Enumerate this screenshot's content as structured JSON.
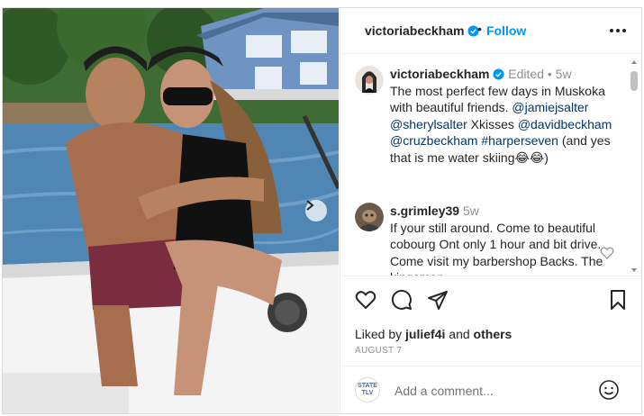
{
  "post": {
    "username": "victoriabeckham",
    "follow_label": "Follow",
    "dot": "•",
    "more_icon": "more-horizontal-icon",
    "verified_color": "#0095f6",
    "accent": "#0095f6"
  },
  "caption": {
    "author": "victoriabeckham",
    "edited": "Edited",
    "sep": "•",
    "age": "5w",
    "text_1": "The most perfect few days in Muskoka with beautiful friends. ",
    "mention_1": "@jamiejsalter",
    "mention_2": "@sherylsalter",
    "text_2": " Xkisses ",
    "mention_3": "@davidbeckham",
    "mention_4": "@cruzbeckham",
    "hashtag_1": "#harperseven",
    "text_3": " (and yes that is me water skiing",
    "emojis": "😂😂",
    "text_4": ")"
  },
  "comments": [
    {
      "author": "s.grimley39",
      "age": "5w",
      "text": "If your still around. Come to beautiful cobourg Ont only 1 hour and bit drive. Come visit my barbershop Backs. The kingsmen"
    }
  ],
  "likes": {
    "prefix": "Liked by ",
    "user": "julief4i",
    "middle": " and ",
    "others": "others"
  },
  "date": "AUGUST 7",
  "composer": {
    "placeholder": "Add a comment...",
    "badge_line1": "STATE",
    "badge_line2": "TLV"
  }
}
